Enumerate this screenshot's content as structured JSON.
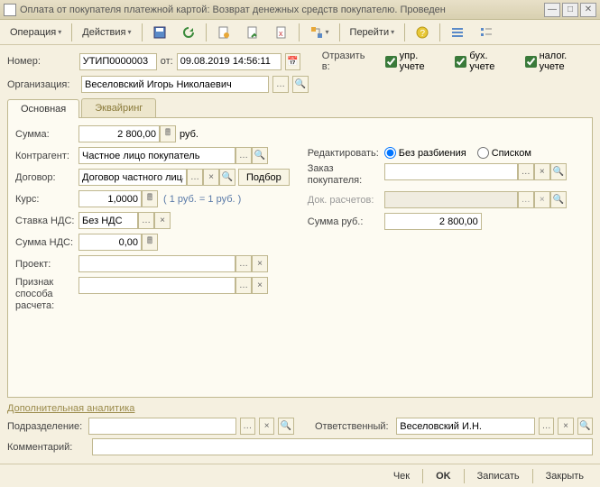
{
  "window": {
    "title": "Оплата от покупателя платежной картой: Возврат денежных средств покупателю. Проведен"
  },
  "toolbar": {
    "operation": "Операция",
    "actions": "Действия",
    "go": "Перейти"
  },
  "header": {
    "number_label": "Номер:",
    "number": "УТИП0000003",
    "from_label": "от:",
    "date": "09.08.2019 14:56:11",
    "reflect_label": "Отразить в:",
    "upr": "упр. учете",
    "buh": "бух. учете",
    "nal": "налог. учете",
    "org_label": "Организация:",
    "org": "Веселовский Игорь Николаевич"
  },
  "tabs": {
    "main": "Основная",
    "acq": "Эквайринг"
  },
  "main": {
    "sum_label": "Сумма:",
    "sum": "2 800,00",
    "rub": "руб.",
    "contr_label": "Контрагент:",
    "contr": "Частное лицо покупатель",
    "dog_label": "Договор:",
    "dog": "Договор частного лица",
    "podbor": "Подбор",
    "kurs_label": "Курс:",
    "kurs": "1,0000",
    "kurs_hint": "( 1 руб. = 1 руб. )",
    "nds_rate_label": "Ставка НДС:",
    "nds_rate": "Без НДС",
    "nds_sum_label": "Сумма НДС:",
    "nds_sum": "0,00",
    "proj_label": "Проект:",
    "sign_label": "Признак способа расчета:"
  },
  "right": {
    "edit_label": "Редактировать:",
    "without": "Без разбиения",
    "list": "Списком",
    "order_label": "Заказ покупателя:",
    "docs_label": "Док. расчетов:",
    "sumrub_label": "Сумма руб.:",
    "sumrub": "2 800,00"
  },
  "extra": {
    "title": "Дополнительная аналитика",
    "dep_label": "Подразделение:",
    "resp_label": "Ответственный:",
    "resp": "Веселовский И.Н.",
    "comm_label": "Комментарий:"
  },
  "footer": {
    "chek": "Чек",
    "ok": "OK",
    "save": "Записать",
    "close": "Закрыть"
  }
}
